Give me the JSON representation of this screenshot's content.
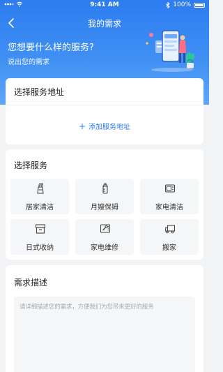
{
  "status_bar": {
    "time": "9:41 AM",
    "battery": "100%"
  },
  "nav": {
    "title": "我的需求"
  },
  "hero": {
    "heading": "您想要什么样的服务?",
    "subheading": "说出您的需求"
  },
  "address": {
    "title": "选择服务地址",
    "add_label": "添加服务地址",
    "add_symbol": "+"
  },
  "services": {
    "title": "选择服务",
    "items": [
      {
        "label": "居家清洁",
        "icon": "spray-bottle-icon"
      },
      {
        "label": "月嫂保姆",
        "icon": "baby-bottle-icon"
      },
      {
        "label": "家电清洁",
        "icon": "appliance-icon"
      },
      {
        "label": "日式收纳",
        "icon": "storage-box-icon"
      },
      {
        "label": "家电维修",
        "icon": "repair-icon"
      },
      {
        "label": "搬家",
        "icon": "truck-icon"
      }
    ]
  },
  "description": {
    "title": "需求描述",
    "placeholder": "请详细描述您的需求，方便我们为您带来更好的服务"
  },
  "colors": {
    "primary": "#2d7cf0",
    "background": "#f2f3f5",
    "item_bg": "#f5f6f8"
  }
}
